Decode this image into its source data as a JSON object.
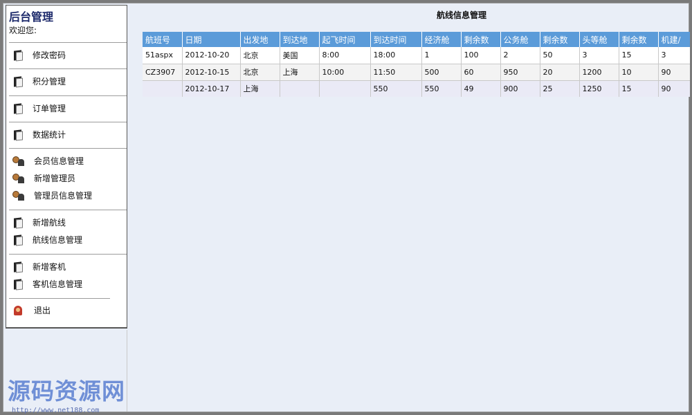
{
  "sidebar": {
    "title": "后台管理",
    "welcome": "欢迎您:",
    "groups": [
      {
        "items": [
          {
            "label": "修改密码",
            "icon": "document-icon"
          }
        ]
      },
      {
        "items": [
          {
            "label": "积分管理",
            "icon": "document-icon"
          }
        ]
      },
      {
        "items": [
          {
            "label": "订单管理",
            "icon": "document-icon"
          }
        ]
      },
      {
        "items": [
          {
            "label": "数据统计",
            "icon": "document-icon"
          }
        ]
      },
      {
        "items": [
          {
            "label": "会员信息管理",
            "icon": "user-icon"
          },
          {
            "label": "新增管理员",
            "icon": "user-icon"
          },
          {
            "label": "管理员信息管理",
            "icon": "user-icon"
          }
        ]
      },
      {
        "items": [
          {
            "label": "新增航线",
            "icon": "document-icon"
          },
          {
            "label": "航线信息管理",
            "icon": "document-icon"
          }
        ]
      },
      {
        "items": [
          {
            "label": "新增客机",
            "icon": "document-icon"
          },
          {
            "label": "客机信息管理",
            "icon": "document-icon"
          }
        ]
      },
      {
        "items": [
          {
            "label": "退出",
            "icon": "exit-icon"
          }
        ]
      }
    ]
  },
  "main": {
    "heading": "航线信息管理",
    "table": {
      "headers": [
        "航班号",
        "日期",
        "出发地",
        "到达地",
        "起飞时间",
        "到达时间",
        "经济舱",
        "剩余数",
        "公务舱",
        "剩余数",
        "头等舱",
        "剩余数",
        "机建/"
      ],
      "rows": [
        [
          "51aspx",
          "2012-10-20",
          "北京",
          "美国",
          "8:00",
          "18:00",
          "1",
          "100",
          "2",
          "50",
          "3",
          "15",
          "3"
        ],
        [
          "CZ3907",
          "2012-10-15",
          "北京",
          "上海",
          "10:00",
          "11:50",
          "500",
          "60",
          "950",
          "20",
          "1200",
          "10",
          "90"
        ],
        [
          "",
          "2012-10-17",
          "上海",
          "",
          "",
          "550",
          "550",
          "49",
          "900",
          "25",
          "1250",
          "15",
          "90"
        ]
      ]
    }
  },
  "watermark": {
    "text": "源码资源网",
    "url": "http://www.net188.com"
  }
}
